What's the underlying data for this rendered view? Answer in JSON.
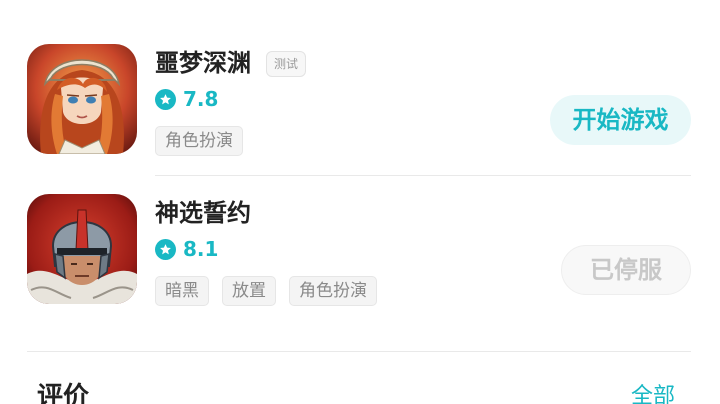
{
  "games": [
    {
      "title": "噩梦深渊",
      "badge": "测试",
      "rating": "7.8",
      "tags": [
        "角色扮演"
      ],
      "action_label": "开始游戏",
      "icon": "heroine-portrait-icon"
    },
    {
      "title": "神选誓约",
      "badge": "",
      "rating": "8.1",
      "tags": [
        "暗黑",
        "放置",
        "角色扮演"
      ],
      "action_label": "已停服",
      "icon": "knight-helmet-icon"
    }
  ],
  "reviews": {
    "section_title": "评价",
    "see_all_label": "全部"
  },
  "colors": {
    "accent": "#19b8c4",
    "title_text": "#222222",
    "tag_text": "#8a8a8a",
    "disabled_text": "#c8c8c8"
  }
}
